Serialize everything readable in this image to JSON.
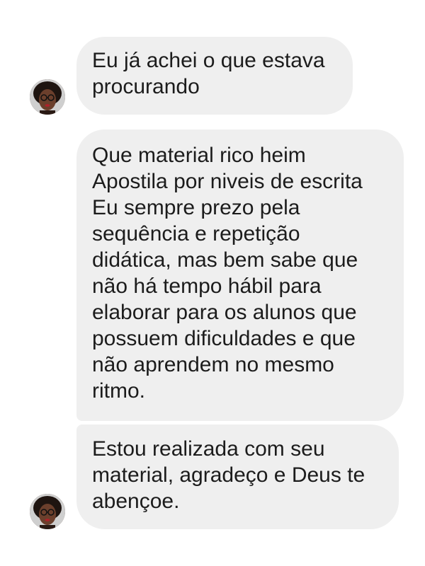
{
  "conversation": {
    "messages": [
      {
        "text": "Eu já achei o que estava\nprocurando"
      },
      {
        "text": "Que material rico heim\nApostila por niveis de escrita\nEu sempre prezo pela\nsequência e repetição\ndidática, mas bem sabe que\nnão há tempo hábil para\nelaborar para os alunos que\npossuem dificuldades e que\nnão aprendem no mesmo\nritmo."
      },
      {
        "text": "Estou realizada com seu\nmaterial, agradeço e Deus te\nabençoe."
      }
    ],
    "avatar_icon": "profile-photo-avatar",
    "colors": {
      "bubble_background": "#efefef",
      "text": "#1c1c1c",
      "background": "#ffffff"
    }
  }
}
